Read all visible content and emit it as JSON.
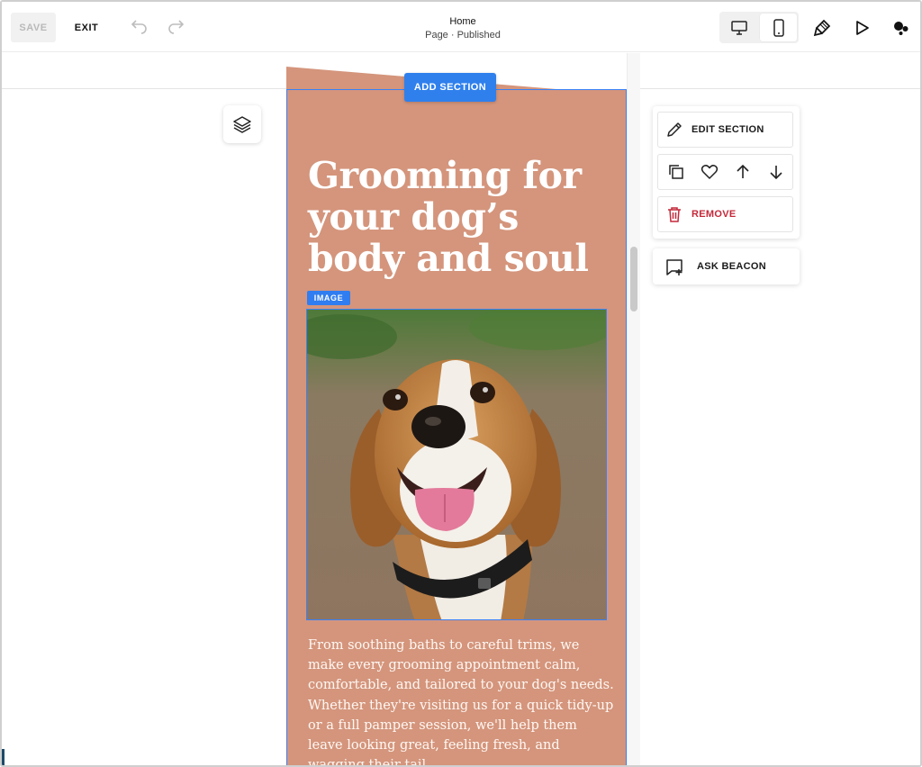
{
  "toolbar": {
    "save_label": "SAVE",
    "exit_label": "EXIT",
    "page_title": "Home",
    "page_status": "Page · Published"
  },
  "canvas": {
    "add_section_label": "ADD SECTION",
    "section": {
      "headline": "Grooming for your dog’s body and soul",
      "image_tag": "IMAGE",
      "body": "From soothing baths to careful trims, we make every grooming appointment calm, comfortable, and tailored to your dog's needs. Whether they're visiting us for a quick tidy-up or a full pamper session, we'll help them leave looking great, feeling fresh, and wagging their tail.",
      "background_color": "#d4957c"
    }
  },
  "section_panel": {
    "edit_label": "EDIT SECTION",
    "remove_label": "REMOVE"
  },
  "beacon": {
    "label": "ASK BEACON"
  },
  "icons": [
    "undo-icon",
    "redo-icon",
    "desktop-icon",
    "mobile-icon",
    "paintbrush-icon",
    "play-icon",
    "beacon-dots-icon",
    "layers-icon",
    "pencil-icon",
    "duplicate-icon",
    "heart-icon",
    "arrow-up-icon",
    "arrow-down-icon",
    "trash-icon",
    "ask-beacon-icon"
  ],
  "colors": {
    "accent": "#2f80ed",
    "selection": "#3b82f6",
    "remove": "#c4293a"
  }
}
